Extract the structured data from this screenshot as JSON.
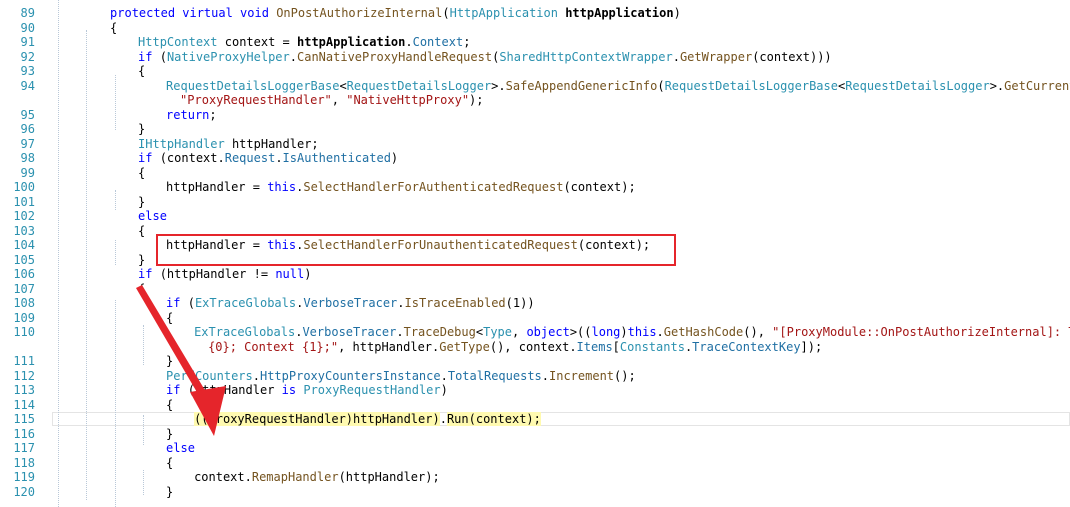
{
  "editor": {
    "lines": [
      {
        "num": "89",
        "indent": 4,
        "segs": [
          [
            "kw",
            "protected virtual void "
          ],
          [
            "method",
            "OnPostAuthorizeInternal"
          ],
          [
            "plain",
            "("
          ],
          [
            "type",
            "HttpApplication"
          ],
          [
            "plain",
            " "
          ],
          [
            "bold",
            "httpApplication"
          ],
          [
            "plain",
            ")"
          ]
        ]
      },
      {
        "num": "90",
        "indent": 4,
        "segs": [
          [
            "plain",
            "{"
          ]
        ]
      },
      {
        "num": "91",
        "indent": 6,
        "segs": [
          [
            "type",
            "HttpContext"
          ],
          [
            "plain",
            " context = "
          ],
          [
            "bold",
            "httpApplication"
          ],
          [
            "plain",
            "."
          ],
          [
            "prop",
            "Context"
          ],
          [
            "plain",
            ";"
          ]
        ]
      },
      {
        "num": "92",
        "indent": 6,
        "segs": [
          [
            "kw",
            "if"
          ],
          [
            "plain",
            " ("
          ],
          [
            "type",
            "NativeProxyHelper"
          ],
          [
            "plain",
            "."
          ],
          [
            "method",
            "CanNativeProxyHandleRequest"
          ],
          [
            "plain",
            "("
          ],
          [
            "type",
            "SharedHttpContextWrapper"
          ],
          [
            "plain",
            "."
          ],
          [
            "method",
            "GetWrapper"
          ],
          [
            "plain",
            "(context)))"
          ]
        ]
      },
      {
        "num": "93",
        "indent": 6,
        "segs": [
          [
            "plain",
            "{"
          ]
        ]
      },
      {
        "num": "94",
        "indent": 8,
        "segs": [
          [
            "type",
            "RequestDetailsLoggerBase"
          ],
          [
            "plain",
            "<"
          ],
          [
            "type",
            "RequestDetailsLogger"
          ],
          [
            "plain",
            ">."
          ],
          [
            "method",
            "SafeAppendGenericInfo"
          ],
          [
            "plain",
            "("
          ],
          [
            "type",
            "RequestDetailsLoggerBase"
          ],
          [
            "plain",
            "<"
          ],
          [
            "type",
            "RequestDetailsLogger"
          ],
          [
            "plain",
            ">."
          ],
          [
            "method",
            "GetCurrent"
          ],
          [
            "plain",
            "(con"
          ]
        ]
      },
      {
        "num": "",
        "indent": 9,
        "segs": [
          [
            "str",
            "\"ProxyRequestHandler\""
          ],
          [
            "plain",
            ", "
          ],
          [
            "str",
            "\"NativeHttpProxy\""
          ],
          [
            "plain",
            ");"
          ]
        ]
      },
      {
        "num": "95",
        "indent": 8,
        "segs": [
          [
            "kw",
            "return"
          ],
          [
            "plain",
            ";"
          ]
        ]
      },
      {
        "num": "96",
        "indent": 6,
        "segs": [
          [
            "plain",
            "}"
          ]
        ]
      },
      {
        "num": "97",
        "indent": 6,
        "segs": [
          [
            "type",
            "IHttpHandler"
          ],
          [
            "plain",
            " httpHandler;"
          ]
        ]
      },
      {
        "num": "98",
        "indent": 6,
        "segs": [
          [
            "kw",
            "if"
          ],
          [
            "plain",
            " (context."
          ],
          [
            "prop",
            "Request"
          ],
          [
            "plain",
            "."
          ],
          [
            "prop",
            "IsAuthenticated"
          ],
          [
            "plain",
            ")"
          ]
        ]
      },
      {
        "num": "99",
        "indent": 6,
        "segs": [
          [
            "plain",
            "{"
          ]
        ]
      },
      {
        "num": "100",
        "indent": 8,
        "segs": [
          [
            "plain",
            "httpHandler = "
          ],
          [
            "kw",
            "this"
          ],
          [
            "plain",
            "."
          ],
          [
            "method",
            "SelectHandlerForAuthenticatedRequest"
          ],
          [
            "plain",
            "(context);"
          ]
        ]
      },
      {
        "num": "101",
        "indent": 6,
        "segs": [
          [
            "plain",
            "}"
          ]
        ]
      },
      {
        "num": "102",
        "indent": 6,
        "segs": [
          [
            "kw",
            "else"
          ]
        ]
      },
      {
        "num": "103",
        "indent": 6,
        "segs": [
          [
            "plain",
            "{"
          ]
        ]
      },
      {
        "num": "104",
        "indent": 8,
        "segs": [
          [
            "plain",
            "httpHandler = "
          ],
          [
            "kw",
            "this"
          ],
          [
            "plain",
            "."
          ],
          [
            "method",
            "SelectHandlerForUnauthenticatedRequest"
          ],
          [
            "plain",
            "(context);"
          ]
        ]
      },
      {
        "num": "105",
        "indent": 6,
        "segs": [
          [
            "plain",
            "}"
          ]
        ]
      },
      {
        "num": "106",
        "indent": 6,
        "segs": [
          [
            "kw",
            "if"
          ],
          [
            "plain",
            " (httpHandler != "
          ],
          [
            "kw",
            "null"
          ],
          [
            "plain",
            ")"
          ]
        ]
      },
      {
        "num": "107",
        "indent": 6,
        "segs": [
          [
            "plain",
            "{"
          ]
        ]
      },
      {
        "num": "108",
        "indent": 8,
        "segs": [
          [
            "kw",
            "if"
          ],
          [
            "plain",
            " ("
          ],
          [
            "type",
            "ExTraceGlobals"
          ],
          [
            "plain",
            "."
          ],
          [
            "prop",
            "VerboseTracer"
          ],
          [
            "plain",
            "."
          ],
          [
            "method",
            "IsTraceEnabled"
          ],
          [
            "plain",
            "(1))"
          ]
        ]
      },
      {
        "num": "109",
        "indent": 8,
        "segs": [
          [
            "plain",
            "{"
          ]
        ]
      },
      {
        "num": "110",
        "indent": 10,
        "segs": [
          [
            "type",
            "ExTraceGlobals"
          ],
          [
            "plain",
            "."
          ],
          [
            "prop",
            "VerboseTracer"
          ],
          [
            "plain",
            "."
          ],
          [
            "method",
            "TraceDebug"
          ],
          [
            "plain",
            "<"
          ],
          [
            "type",
            "Type"
          ],
          [
            "plain",
            ", "
          ],
          [
            "kw",
            "object"
          ],
          [
            "plain",
            ">(("
          ],
          [
            "kw",
            "long"
          ],
          [
            "plain",
            ")"
          ],
          [
            "kw",
            "this"
          ],
          [
            "plain",
            "."
          ],
          [
            "method",
            "GetHashCode"
          ],
          [
            "plain",
            "(), "
          ],
          [
            "str",
            "\"[ProxyModule::OnPostAuthorizeInternal]: The"
          ]
        ]
      },
      {
        "num": "",
        "indent": 11,
        "segs": [
          [
            "str",
            "{0}; Context {1};\""
          ],
          [
            "plain",
            ", httpHandler."
          ],
          [
            "method",
            "GetType"
          ],
          [
            "plain",
            "(), context."
          ],
          [
            "prop",
            "Items"
          ],
          [
            "plain",
            "["
          ],
          [
            "type",
            "Constants"
          ],
          [
            "plain",
            "."
          ],
          [
            "prop",
            "TraceContextKey"
          ],
          [
            "plain",
            "]);"
          ]
        ]
      },
      {
        "num": "111",
        "indent": 8,
        "segs": [
          [
            "plain",
            "}"
          ]
        ]
      },
      {
        "num": "112",
        "indent": 8,
        "segs": [
          [
            "type",
            "PerfCounters"
          ],
          [
            "plain",
            "."
          ],
          [
            "prop",
            "HttpProxyCountersInstance"
          ],
          [
            "plain",
            "."
          ],
          [
            "prop",
            "TotalRequests"
          ],
          [
            "plain",
            "."
          ],
          [
            "method",
            "Increment"
          ],
          [
            "plain",
            "();"
          ]
        ]
      },
      {
        "num": "113",
        "indent": 8,
        "segs": [
          [
            "kw",
            "if"
          ],
          [
            "plain",
            " (httpHandler "
          ],
          [
            "kw",
            "is"
          ],
          [
            "plain",
            " "
          ],
          [
            "type",
            "ProxyRequestHandler"
          ],
          [
            "plain",
            ")"
          ]
        ]
      },
      {
        "num": "114",
        "indent": 8,
        "segs": [
          [
            "plain",
            "{"
          ]
        ]
      },
      {
        "num": "115",
        "indent": 10,
        "current": true,
        "segs": [
          [
            "hl",
            "("
          ],
          [
            "hl",
            "(ProxyRequestHandler)httpHandler"
          ],
          [
            "hl",
            ")"
          ],
          [
            "plain",
            "."
          ],
          [
            "hl",
            "Run(context);"
          ]
        ]
      },
      {
        "num": "116",
        "indent": 8,
        "segs": [
          [
            "plain",
            "}"
          ]
        ]
      },
      {
        "num": "117",
        "indent": 8,
        "segs": [
          [
            "kw",
            "else"
          ]
        ]
      },
      {
        "num": "118",
        "indent": 8,
        "segs": [
          [
            "plain",
            "{"
          ]
        ]
      },
      {
        "num": "119",
        "indent": 10,
        "segs": [
          [
            "plain",
            "context."
          ],
          [
            "method",
            "RemapHandler"
          ],
          [
            "plain",
            "(httpHandler);"
          ]
        ]
      },
      {
        "num": "120",
        "indent": 8,
        "segs": [
          [
            "plain",
            "}"
          ]
        ]
      }
    ]
  },
  "annotation": {
    "box_color": "#e5252b",
    "arrow_color": "#e5252b"
  }
}
